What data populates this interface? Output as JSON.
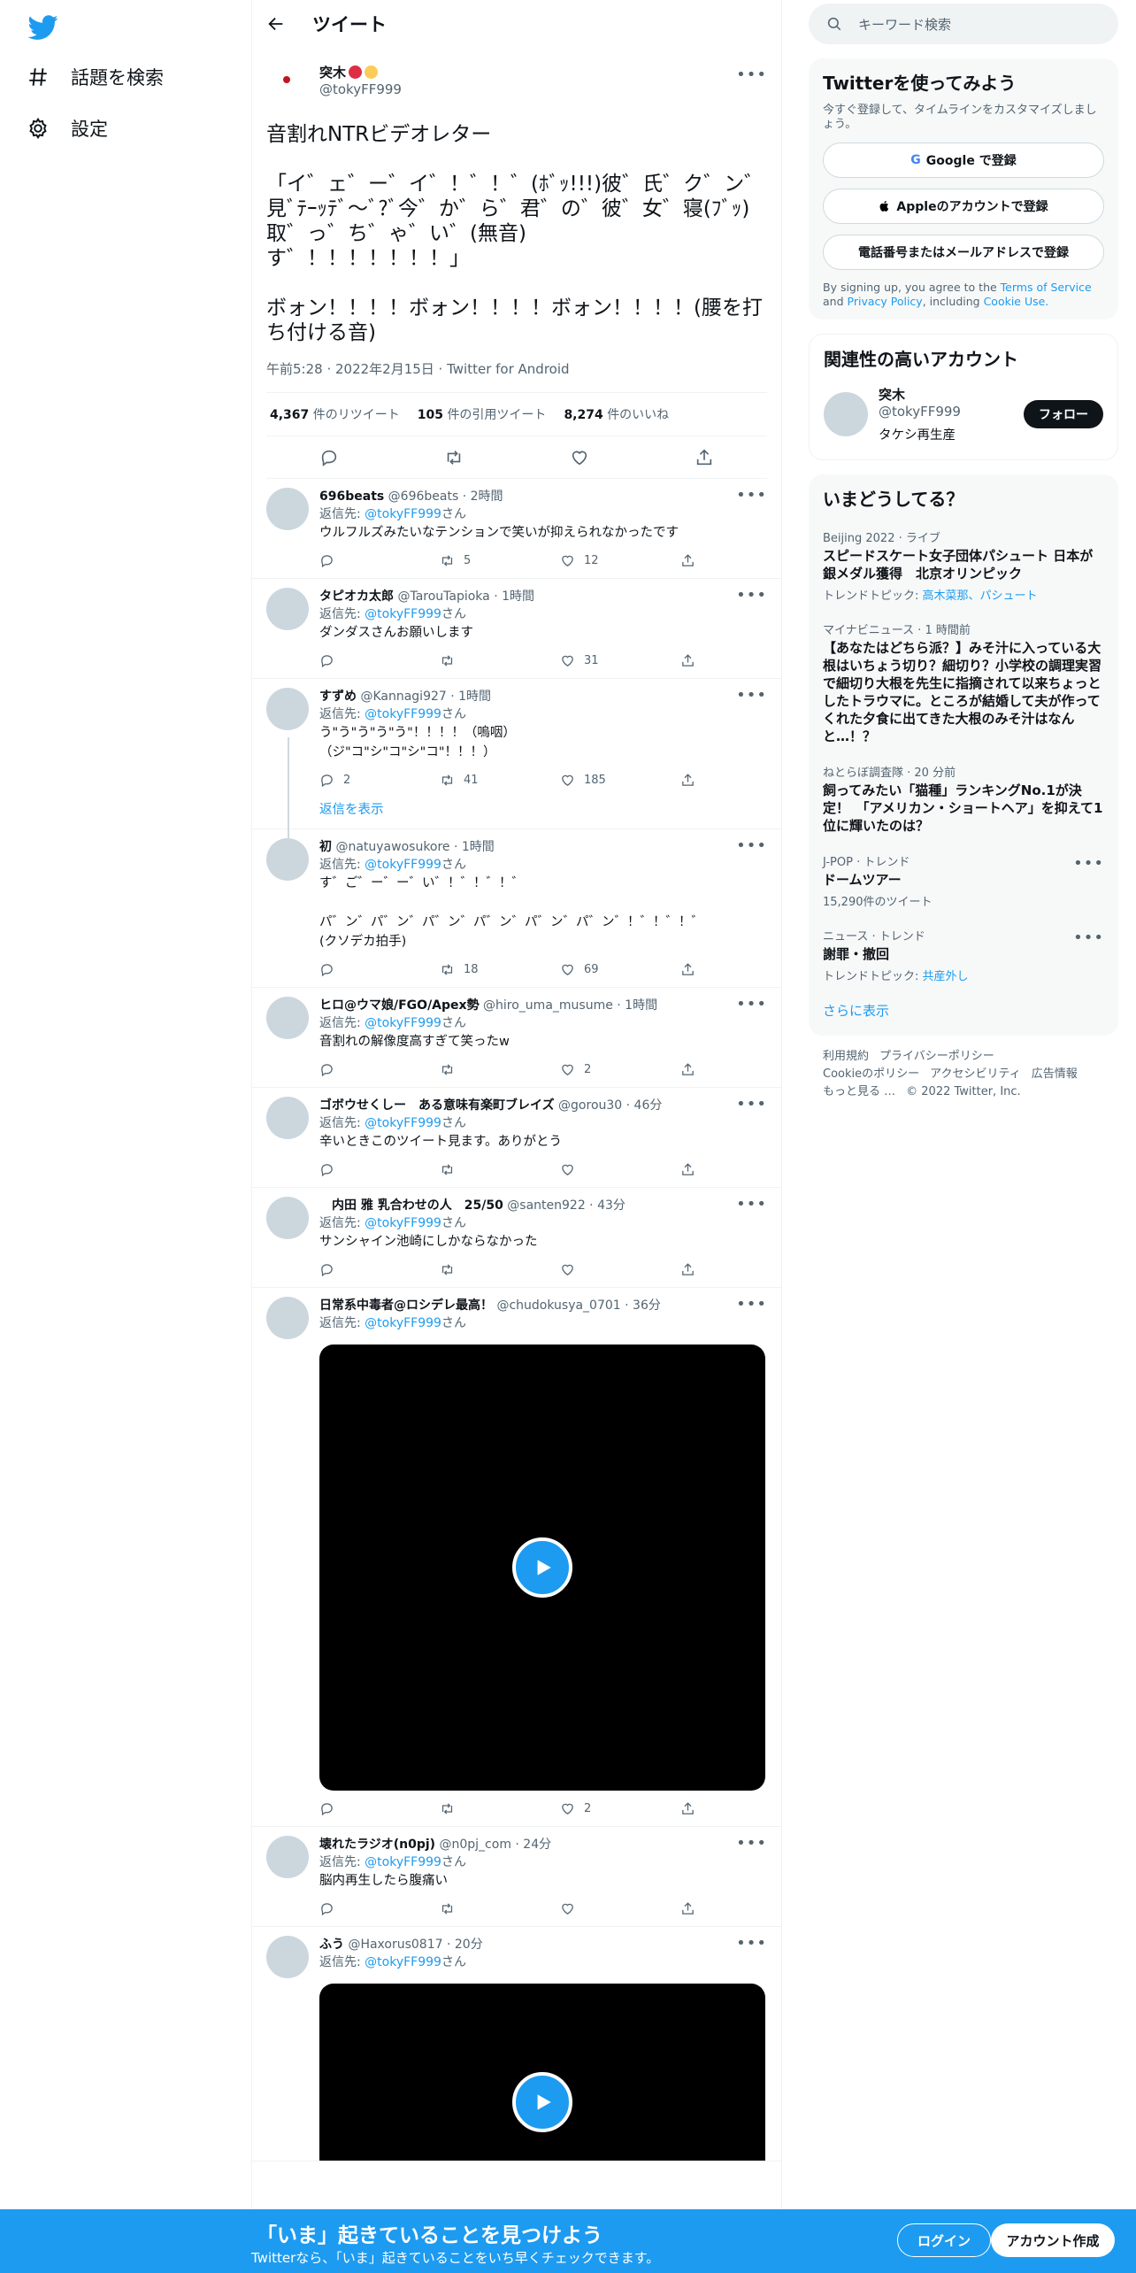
{
  "nav": {
    "explore_label": "話題を検索",
    "settings_label": "設定"
  },
  "header": {
    "title": "ツイート"
  },
  "focal": {
    "name": "突木",
    "handle": "@tokyFF999",
    "text": "音割れNTRビデオレター\n\n「イ゛ェ゛ー゛イ゛！゛！゛(ﾎﾞｯ!!!)彼゛氏゛ク゛ン゛見ﾞﾃｰｯﾃﾞ〜ﾞ?ﾞ今゛か゛ら゛君゛の゛彼゛女゛寝(ﾌﾞｯ)取゛っ゛ち゛ゃ゛い゛(無音)\nす゛！！！！！！！」\n\nボォン！！！！ボォン！！！！ボォン！！！！(腰を打ち付ける音)",
    "meta": "午前5:28 · 2022年2月15日 · Twitter for Android",
    "retweets": "4,367",
    "retweets_label": "件のリツイート",
    "quotes": "105",
    "quotes_label": "件の引用ツイート",
    "likes": "8,274",
    "likes_label": "件のいいね"
  },
  "reply_to_label": "返信先:",
  "reply_to_handle": "@tokyFF999",
  "reply_to_suffix": "さん",
  "show_replies": "返信を表示",
  "replies": [
    {
      "name": "696beats",
      "handle": "@696beats · 2時間",
      "text": "ウルフルズみたいなテンションで笑いが抑えられなかったです",
      "reply": "",
      "rt": "5",
      "like": "12"
    },
    {
      "name": "タピオカ太郎",
      "handle": "@TarouTapioka · 1時間",
      "text": "ダンダスさんお願いします",
      "reply": "",
      "rt": "",
      "like": "31"
    },
    {
      "name": "すずめ",
      "handle": "@Kannagi927 · 1時間",
      "text": "う\"う\"う\"う\"う\"！！！！（嗚咽）\n（ジ\"コ\"シ\"コ\"シ\"コ\"！！！）",
      "reply": "2",
      "rt": "41",
      "like": "185"
    },
    {
      "name": "初",
      "handle": "@natuyawosukore · 1時間",
      "text": "す゛ご゛ー゛ー゛い゛！゛！゛！゛\n\nパ゛ン゛パ゛ン゛パ゛ン゛パ゛ン゛パ゛ン゛パ゛ン゛！゛！゛！゛\n(クソデカ拍手)",
      "reply": "",
      "rt": "18",
      "like": "69"
    },
    {
      "name": "ヒロ@ウマ娘/FGO/Apex勢",
      "handle": "@hiro_uma_musume · 1時間",
      "text": "音割れの解像度高すぎて笑ったw",
      "reply": "",
      "rt": "",
      "like": "2"
    },
    {
      "name": "ゴボウせくしー　ある意味有楽町ブレイズ",
      "handle": "@gorou30 · 46分",
      "text": "辛いときこのツイート見ます。ありがとう",
      "reply": "",
      "rt": "",
      "like": ""
    },
    {
      "name": "　内田 雅 乳合わせの人　25/50",
      "handle": "@santen922 · 43分",
      "text": "サンシャイン池崎にしかならなかった",
      "reply": "",
      "rt": "",
      "like": ""
    },
    {
      "name": "日常系中毒者@ロシデレ最高！",
      "handle": "@chudokusya_0701 · 36分",
      "text": "",
      "reply": "",
      "rt": "",
      "like": "2"
    },
    {
      "name": "壊れたラジオ(n0pj)",
      "handle": "@n0pj_com · 24分",
      "text": "脳内再生したら腹痛い",
      "reply": "",
      "rt": "",
      "like": ""
    },
    {
      "name": "ふう",
      "handle": "@Haxorus0817 · 20分",
      "text": "",
      "reply": "",
      "rt": "",
      "like": ""
    }
  ],
  "right": {
    "search_placeholder": "キーワード検索",
    "signup_title": "Twitterを使ってみよう",
    "signup_sub": "今すぐ登録して、タイムラインをカスタマイズしましょう。",
    "google_btn": "Google で登録",
    "apple_btn": "Appleのアカウントで登録",
    "phone_btn": "電話番号またはメールアドレスで登録",
    "legal_pre": "By signing up, you agree to the",
    "tos": "Terms of Service",
    "legal_and": "and",
    "privacy": "Privacy Policy",
    "legal_inc": ", including",
    "cookie": "Cookie Use.",
    "related_title": "関連性の高いアカウント",
    "rel_name": "突木",
    "rel_handle": "@tokyFF999",
    "rel_bio": "タケシ再生産",
    "follow": "フォロー",
    "trends_title": "いまどうしてる？",
    "trends": [
      {
        "ctx": "Beijing 2022 · ライブ",
        "title": "スピードスケート女子団体パシュート 日本が銀メダル獲得　北京オリンピック",
        "topic": "トレンドトピック:",
        "topic_link": "高木菜那、パシュート"
      },
      {
        "ctx": "マイナビニュース · 1 時間前",
        "title": "【あなたはどちら派？】みそ汁に入っている大根はいちょう切り？細切り？小学校の調理実習で細切り大根を先生に指摘されて以来ちょっとしたトラウマに。ところが結婚して夫が作ってくれた夕食に出てきた大根のみそ汁はなんと…！？",
        "topic": "",
        "topic_link": ""
      },
      {
        "ctx": "ねとらぼ調査隊 · 20 分前",
        "title": "飼ってみたい「猫種」ランキングNo.1が決定！　「アメリカン・ショートヘア」を抑えて1位に輝いたのは？",
        "topic": "",
        "topic_link": ""
      },
      {
        "ctx": "J-POP · トレンド",
        "title": "ドームツアー",
        "topic": "15,290件のツイート",
        "topic_link": ""
      },
      {
        "ctx": "ニュース · トレンド",
        "title": "謝罪・撤回",
        "topic": "トレンドトピック:",
        "topic_link": "共産外し"
      }
    ],
    "show_more": "さらに表示",
    "footer": [
      "利用規約",
      "プライバシーポリシー",
      "Cookieのポリシー",
      "アクセシビリティ",
      "広告情報",
      "もっと見る …",
      "© 2022 Twitter, Inc."
    ]
  },
  "bottom": {
    "title": "「いま」起きていることを見つけよう",
    "sub": "Twitterなら、「いま」起きていることをいち早くチェックできます。",
    "login": "ログイン",
    "signup": "アカウント作成"
  },
  "colors": {
    "accent": "#1d9bf0",
    "text": "#0f1419",
    "muted": "#536471"
  }
}
